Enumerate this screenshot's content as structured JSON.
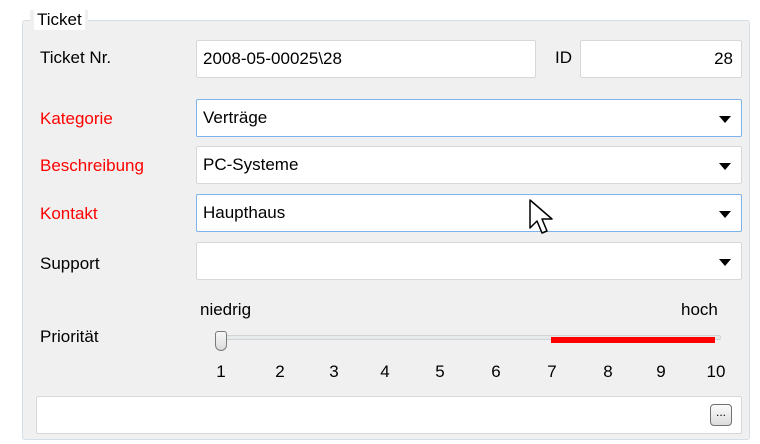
{
  "groupbox": {
    "title": "Ticket"
  },
  "fields": {
    "ticket_nr": {
      "label": "Ticket Nr.",
      "value": "2008-05-00025\\28"
    },
    "id": {
      "label": "ID",
      "value": "28"
    },
    "kategorie": {
      "label": "Kategorie",
      "value": "Verträge"
    },
    "beschreibung": {
      "label": "Beschreibung",
      "value": "PC-Systeme"
    },
    "kontakt": {
      "label": "Kontakt",
      "value": "Haupthaus"
    },
    "support": {
      "label": "Support",
      "value": ""
    }
  },
  "priority": {
    "label": "Priorität",
    "low_label": "niedrig",
    "high_label": "hoch",
    "ticks": [
      "1",
      "2",
      "3",
      "4",
      "5",
      "6",
      "7",
      "8",
      "9",
      "10"
    ],
    "value": 1,
    "highlight_range": [
      7,
      10
    ]
  },
  "bottom_field": {
    "value": "",
    "button_label": "..."
  },
  "colors": {
    "required_label": "#ff0000",
    "range_highlight": "#ff0000",
    "focus_border": "#7eb4ea"
  },
  "icons": {
    "dropdown": "chevron-down-icon",
    "pointer": "mouse-pointer-icon"
  }
}
